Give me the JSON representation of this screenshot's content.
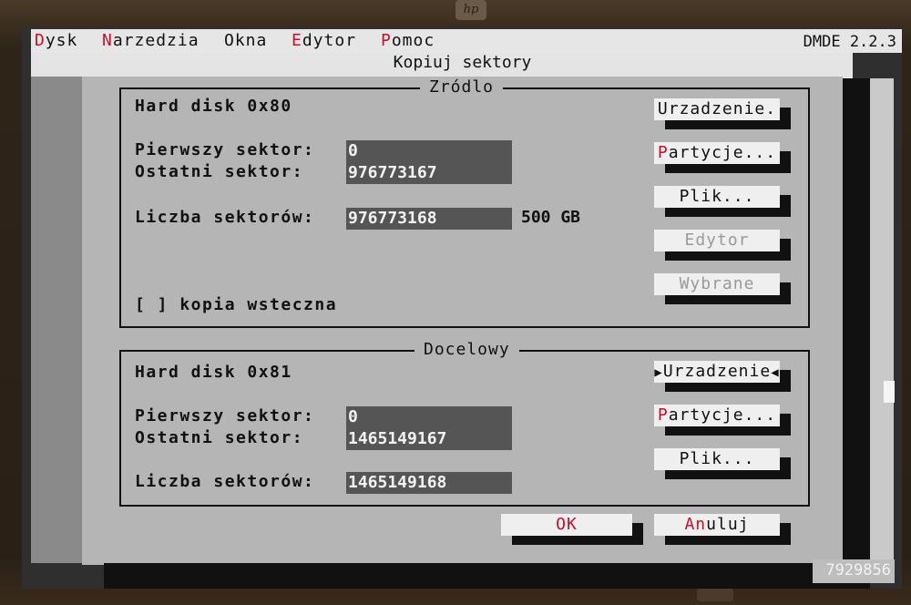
{
  "bezel": {
    "logo": "hp"
  },
  "menubar": {
    "items": [
      {
        "hot": "D",
        "rest": "ysk"
      },
      {
        "hot": "N",
        "rest": "arzedzia"
      },
      {
        "hot": "",
        "rest": "Okna"
      },
      {
        "hot": "E",
        "rest": "dytor"
      },
      {
        "hot": "P",
        "rest": "omoc"
      }
    ],
    "version": "DMDE 2.2.3"
  },
  "dialog": {
    "title": "Kopiuj sektory",
    "source": {
      "title": "Zródlo",
      "device": "Hard disk 0x80",
      "first_sector_label": "Pierwszy sektor:",
      "first_sector": "0",
      "last_sector_label": "Ostatni sektor:",
      "last_sector": "976773167",
      "count_label": "Liczba sektorów:",
      "count": "976773168",
      "size": "500 GB",
      "reverse_copy_label": "[ ] kopia wsteczna",
      "buttons": {
        "device": {
          "pre": "",
          "hot": "",
          "text": "Urzadzenie."
        },
        "partitions": {
          "pre": "",
          "hot": "P",
          "text": "artycje..."
        },
        "file": {
          "pre": "",
          "hot": "",
          "text": "Plik..."
        },
        "editor": {
          "text": "Edytor"
        },
        "selected": {
          "text": "Wybrane"
        }
      }
    },
    "target": {
      "title": "Docelowy",
      "device": "Hard disk 0x81",
      "first_sector_label": "Pierwszy sektor:",
      "first_sector": "0",
      "last_sector_label": "Ostatni sektor:",
      "last_sector": "1465149167",
      "count_label": "Liczba sektorów:",
      "count": "1465149168",
      "buttons": {
        "device": {
          "left_arrow": "▶",
          "text": "Urzadzenie",
          "right_arrow": "◀"
        },
        "partitions": {
          "hot": "P",
          "text": "artycje..."
        },
        "file": {
          "text": "Plik..."
        }
      }
    },
    "ok": {
      "hot": "OK"
    },
    "cancel": {
      "hot": "An",
      "text": "uluj"
    }
  },
  "status": {
    "number": "7929856"
  },
  "colors": {
    "hotkey": "#c8102e",
    "field_bg": "#555555",
    "dialog_bg": "#b5b5b5"
  }
}
